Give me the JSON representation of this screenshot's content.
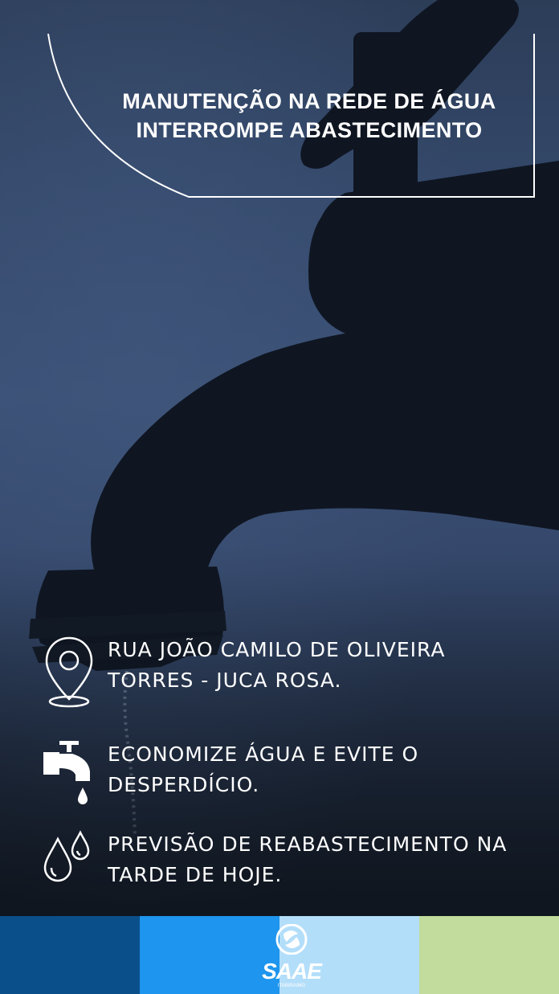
{
  "headline": {
    "line1": "MANUTENÇÃO NA REDE DE ÁGUA",
    "line2": "INTERROMPE ABASTECIMENTO"
  },
  "info_items": [
    {
      "icon": "location-pin-icon",
      "lines": [
        "RUA JOÃO CAMILO DE OLIVEIRA",
        "TORRES - JUCA ROSA."
      ]
    },
    {
      "icon": "faucet-icon",
      "lines": [
        "ECONOMIZE ÁGUA E EVITE O",
        "DESPERDÍCIO."
      ]
    },
    {
      "icon": "water-drops-icon",
      "lines": [
        "PREVISÃO DE REABASTECIMENTO NA",
        "TARDE DE HOJE."
      ]
    }
  ],
  "footer": {
    "stripe_colors": [
      "#0b4f8a",
      "#1e95ee",
      "#b3defa",
      "#c1dc9c"
    ],
    "logo_name": "SAAE",
    "logo_subtitle": "ITABIRA/MG"
  },
  "colors": {
    "background_top": "#2c3d58",
    "background_mid": "#3b5075",
    "background_bottom": "#10151d",
    "text": "#ffffff",
    "faucet_silhouette": "#0f1622"
  }
}
